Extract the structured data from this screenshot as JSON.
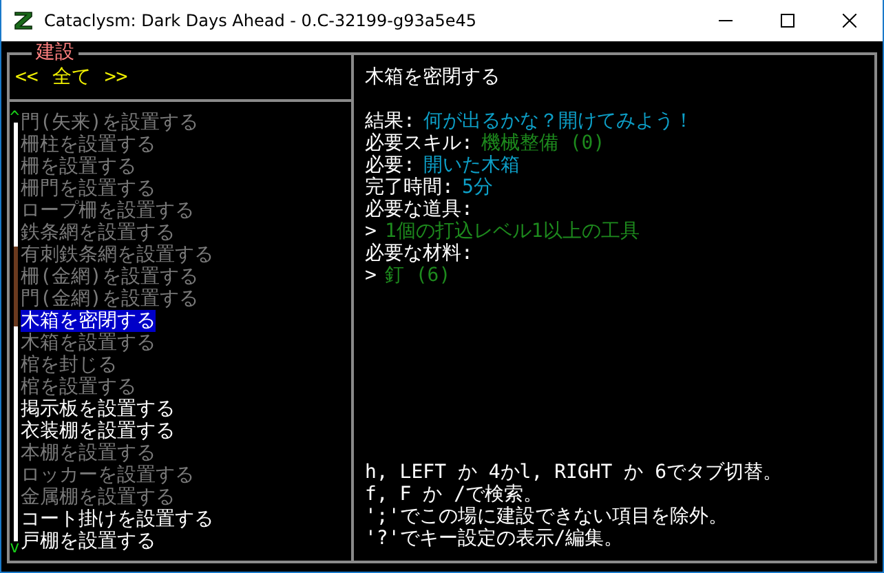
{
  "window": {
    "title": "Cataclysm: Dark Days Ahead - 0.C-32199-g93a5e45"
  },
  "panel": {
    "title": "建設"
  },
  "tab": {
    "prev": "<<",
    "label": "全て",
    "next": ">>"
  },
  "scroll": {
    "up": "^",
    "down": "v"
  },
  "items": [
    {
      "label": "門(矢来)を設置する",
      "available": false,
      "selected": false
    },
    {
      "label": "柵柱を設置する",
      "available": false,
      "selected": false
    },
    {
      "label": "柵を設置する",
      "available": false,
      "selected": false
    },
    {
      "label": "柵門を設置する",
      "available": false,
      "selected": false
    },
    {
      "label": "ロープ柵を設置する",
      "available": false,
      "selected": false
    },
    {
      "label": "鉄条網を設置する",
      "available": false,
      "selected": false
    },
    {
      "label": "有刺鉄条網を設置する",
      "available": false,
      "selected": false
    },
    {
      "label": "柵(金網)を設置する",
      "available": false,
      "selected": false
    },
    {
      "label": "門(金網)を設置する",
      "available": false,
      "selected": false
    },
    {
      "label": "木箱を密閉する",
      "available": false,
      "selected": true
    },
    {
      "label": "木箱を設置する",
      "available": false,
      "selected": false
    },
    {
      "label": "棺を封じる",
      "available": false,
      "selected": false
    },
    {
      "label": "棺を設置する",
      "available": false,
      "selected": false
    },
    {
      "label": "掲示板を設置する",
      "available": true,
      "selected": false
    },
    {
      "label": "衣装棚を設置する",
      "available": true,
      "selected": false
    },
    {
      "label": "本棚を設置する",
      "available": false,
      "selected": false
    },
    {
      "label": "ロッカーを設置する",
      "available": false,
      "selected": false
    },
    {
      "label": "金属棚を設置する",
      "available": false,
      "selected": false
    },
    {
      "label": "コート掛けを設置する",
      "available": true,
      "selected": false
    },
    {
      "label": "戸棚を設置する",
      "available": true,
      "selected": false
    }
  ],
  "detail": {
    "title": "木箱を密閉する",
    "lines": [
      {
        "label": "結果:",
        "value": "何が出るかな？開けてみよう！",
        "color": "#0da0c8"
      },
      {
        "label": "必要スキル:",
        "value": "機械整備 (0)",
        "color": "#1d8a1d"
      },
      {
        "label": "必要:",
        "value": "開いた木箱",
        "color": "#0da0c8"
      },
      {
        "label": "完了時間:",
        "value": "5分",
        "color": "#0da0c8"
      },
      {
        "label": "必要な道具:"
      },
      {
        "label": ">",
        "value": "1個の打込レベル1以上の工具",
        "color": "#1d8a1d"
      },
      {
        "label": "必要な材料:"
      },
      {
        "label": ">",
        "value": "釘 (6)",
        "color": "#1d8a1d"
      }
    ]
  },
  "help": [
    "h, LEFT か 4かl, RIGHT か 6でタブ切替。",
    "f, F か /で検索。",
    "';'でこの場に建設できない項目を除外。",
    "'?'でキー設定の表示/編集。"
  ]
}
